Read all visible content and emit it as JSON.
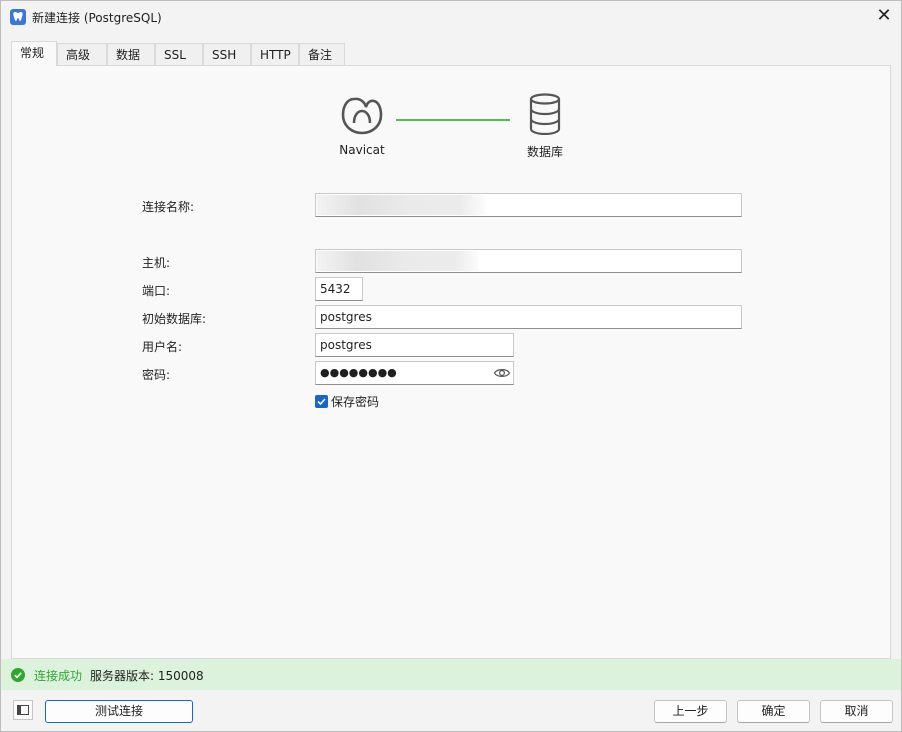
{
  "window": {
    "title": "新建连接 (PostgreSQL)",
    "close_glyph": "✕"
  },
  "tabs": [
    {
      "label": "常规",
      "active": true
    },
    {
      "label": "高级"
    },
    {
      "label": "数据库"
    },
    {
      "label": "SSL"
    },
    {
      "label": "SSH"
    },
    {
      "label": "HTTP"
    },
    {
      "label": "备注"
    }
  ],
  "diagram": {
    "left_label": "Navicat",
    "right_label": "数据库",
    "left_icon": "navicat-logo-icon",
    "right_icon": "database-icon",
    "connector_color": "#4cc04c"
  },
  "form": {
    "connection_name": {
      "label": "连接名称:",
      "value": ""
    },
    "host": {
      "label": "主机:",
      "value": ""
    },
    "port": {
      "label": "端口:",
      "value": "5432"
    },
    "initial_db": {
      "label": "初始数据库:",
      "value": "postgres"
    },
    "username": {
      "label": "用户名:",
      "value": "postgres"
    },
    "password": {
      "label": "密码:",
      "value": "●●●●●●●●"
    },
    "save_password": {
      "label": "保存密码",
      "checked": true
    }
  },
  "status": {
    "ok_text": "连接成功",
    "version_text": "服务器版本: 150008",
    "ok_color": "#31a631",
    "bg_color": "#dcf2dc"
  },
  "footer": {
    "test_button": "测试连接",
    "prev_button": "上一步",
    "ok_button": "确定",
    "cancel_button": "取消"
  }
}
